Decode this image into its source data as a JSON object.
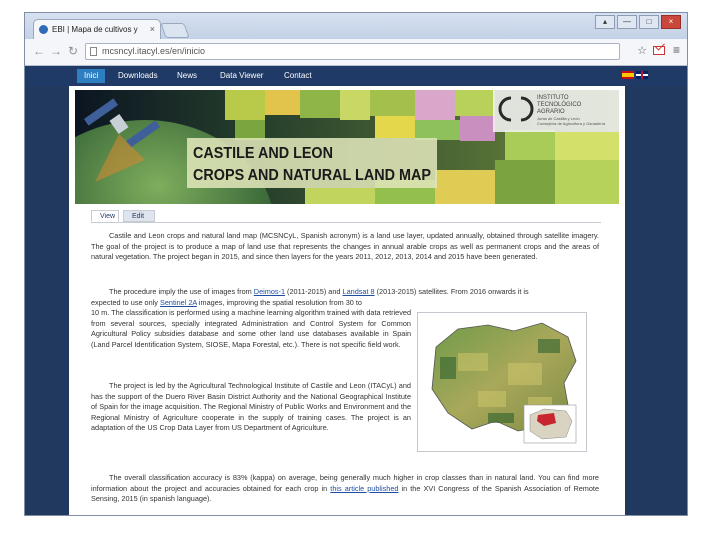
{
  "browser": {
    "tab_title": "EBI | Mapa de cultivos y",
    "tab_close": "×",
    "url": "mcsncyl.itacyl.es/en/inicio",
    "window_controls": [
      "▴",
      "—",
      "□",
      "×"
    ],
    "star_icon": "☆",
    "menu_icon": "≡",
    "mail_badge": "1"
  },
  "site": {
    "nav": [
      "Inici",
      "Downloads",
      "News",
      "Data Viewer",
      "Contact"
    ],
    "languages": [
      "Spanish",
      "English"
    ],
    "banner": {
      "title_line1": "CASTILE AND LEON",
      "title_line2": "CROPS AND NATURAL LAND MAP",
      "logo_name_lines": [
        "INSTITUTO",
        "TECNOLÓGICO",
        "AGRARIO"
      ],
      "logo_sub_lines": [
        "Junta de Castilla y León",
        "Consejería de Agricultura y Ganadería"
      ]
    },
    "page_tabs": [
      "View",
      "Edit"
    ],
    "paragraphs": {
      "p1": "Castile and Leon crops and natural land map (MCSNCyL, Spanish acronym) is a land use layer, updated annually, obtained through satellite imagery. The goal of the project is to produce a map of land use that represents the changes in annual arable crops as well as permanent crops and the areas of natural vegetation. The project began in 2015, and since then layers for the years 2011, 2012, 2013, 2014 and 2015 have been generated.",
      "p2_before_link1": "The procedure imply the use of images from ",
      "p2_link1": "Deimos-1",
      "p2_between": " (2011-2015) and ",
      "p2_link2": "Landsat 8",
      "p2_after_link2": " (2013-2015) satellites. From 2016 onwards it is",
      "p2_line2_before": "expected to use only ",
      "p2_link3": "Sentinel 2A",
      "p2_line2_after": " images, improving the spatial resolution from 30 to",
      "p2_rest": "10 m. The classification is performed using a machine learning algorithm trained with data retrieved from several sources, specially integrated Administration and Control System for Common Agricultural Policy subsidies database and some other land use databases available in Spain (Land Parcel Identification System, SIOSE, Mapa Forestal, etc.). There is not specific field work.",
      "p3": "The project is led by the Agricultural Technological Institute of Castile and Leon (ITACyL) and has the support of the Duero River Basin District Authority and the National Geographical Institute of Spain for the image acquisition. The Regional Ministry of Public Works and Environment and the Regional Ministry of Agriculture cooperate in the supply of training cases. The project is an adaptation of the US Crop Data Layer from US Department of Agriculture.",
      "p4_before_link": "The overall classification accuracy is 83% (kappa) on average, being generally much higher in crop classes than in natural land. You can find more information about the project and accuracies obtained for each crop in ",
      "p4_link": "this article published",
      "p4_after_link": " in the XVI Congress of the Spanish Association of Remote Sensing, 2015 (in spanish language)."
    }
  },
  "colors": {
    "navbar": "#1f3a66",
    "nav_active": "#2d7fc1",
    "link": "#1f4ea1",
    "banner_title": "#1a1a1a"
  }
}
